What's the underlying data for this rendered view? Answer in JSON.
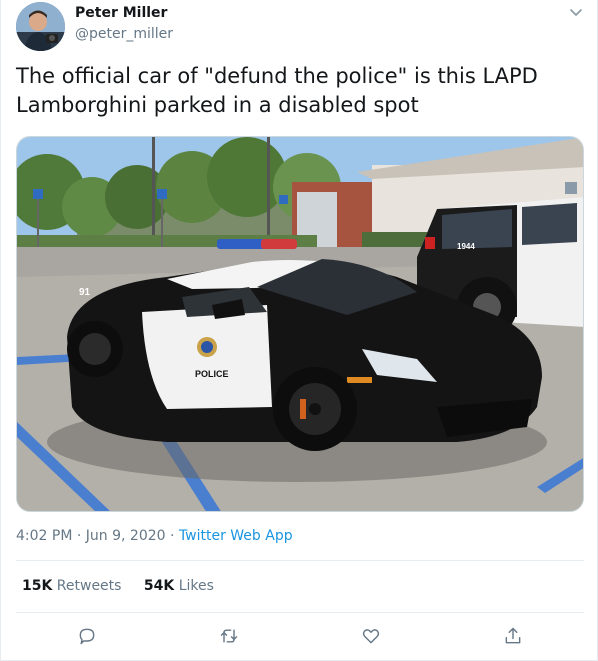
{
  "author": {
    "name": "Peter Miller",
    "handle": "@peter_miller"
  },
  "tweet": {
    "text": "The official car of \"defund the police\" is this LAPD Lamborghini parked in a disabled spot",
    "time": "4:02 PM",
    "date": "Jun 9, 2020",
    "source": "Twitter Web App"
  },
  "media": {
    "car_door_text": "POLICE",
    "car_number": "91",
    "background_car_number": "1944"
  },
  "stats": {
    "retweets_count": "15K",
    "retweets_label": "Retweets",
    "likes_count": "54K",
    "likes_label": "Likes"
  },
  "icons": {
    "reply": "reply-icon",
    "retweet": "retweet-icon",
    "like": "heart-icon",
    "share": "share-icon",
    "menu": "chevron-down-icon"
  },
  "colors": {
    "link": "#1b95e0",
    "muted": "#657786",
    "text": "#14171a",
    "border": "#e6ecf0"
  }
}
